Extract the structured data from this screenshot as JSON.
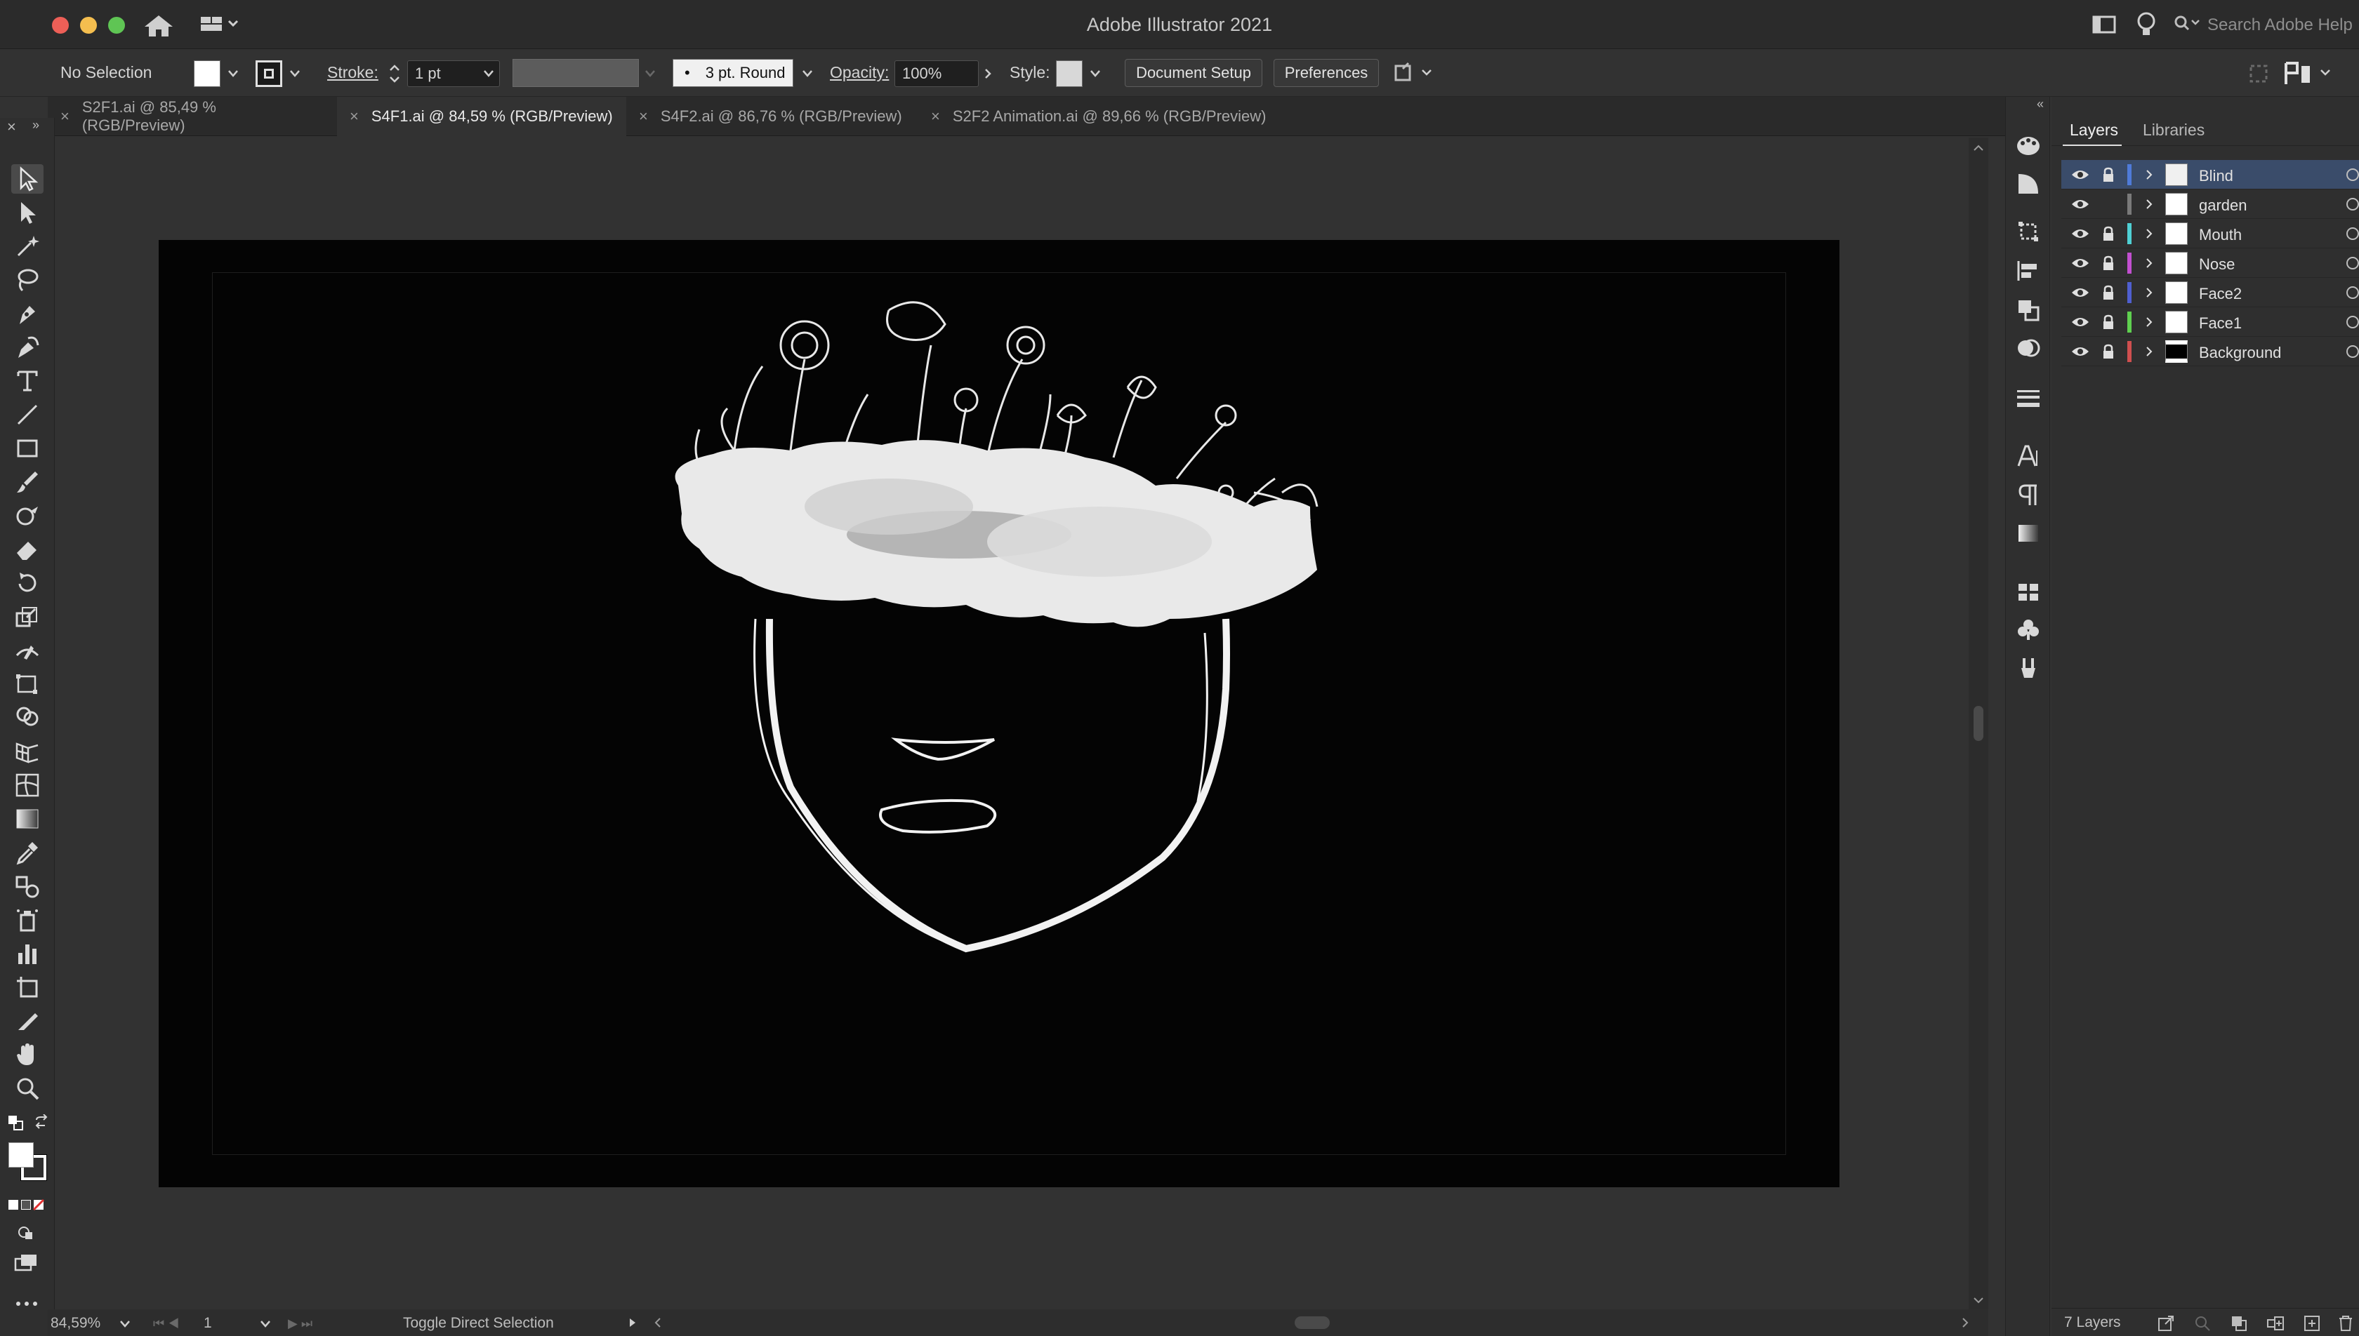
{
  "window": {
    "title": "Adobe Illustrator 2021",
    "help_placeholder": "Search Adobe Help"
  },
  "control_bar": {
    "selection": "No Selection",
    "stroke_label": "Stroke:",
    "stroke_value": "1 pt",
    "brush": "3 pt. Round",
    "opacity_label": "Opacity:",
    "opacity_value": "100%",
    "style_label": "Style:",
    "document_setup": "Document Setup",
    "preferences": "Preferences"
  },
  "tabs": [
    {
      "label": "S2F1.ai @ 85,49 % (RGB/Preview)",
      "active": false
    },
    {
      "label": "S4F1.ai @ 84,59 % (RGB/Preview)",
      "active": true
    },
    {
      "label": "S4F2.ai @ 86,76 % (RGB/Preview)",
      "active": false
    },
    {
      "label": "S2F2 Animation.ai @ 89,66 % (RGB/Preview)",
      "active": false
    }
  ],
  "tools": [
    "selection-tool",
    "direct-selection-tool",
    "magic-wand-tool",
    "lasso-tool",
    "pen-tool",
    "curvature-tool",
    "type-tool",
    "line-segment-tool",
    "rectangle-tool",
    "paintbrush-tool",
    "shaper-tool",
    "eraser-tool",
    "rotate-tool",
    "scale-tool",
    "width-tool",
    "free-transform-tool",
    "shape-builder-tool",
    "perspective-grid-tool",
    "mesh-tool",
    "gradient-tool",
    "eyedropper-tool",
    "blend-tool",
    "symbol-sprayer-tool",
    "column-graph-tool",
    "artboard-tool",
    "slice-tool",
    "hand-tool",
    "zoom-tool"
  ],
  "panel": {
    "tab_layers": "Layers",
    "tab_libraries": "Libraries",
    "layer_count": "7 Layers",
    "layers": [
      {
        "name": "Blind",
        "color": "#4f7bd9",
        "locked": true,
        "visible": true,
        "selected": true
      },
      {
        "name": "garden",
        "color": "#7a7a7a",
        "locked": false,
        "visible": true,
        "selected": false
      },
      {
        "name": "Mouth",
        "color": "#4fd0d4",
        "locked": true,
        "visible": true,
        "selected": false
      },
      {
        "name": "Nose",
        "color": "#c24fd0",
        "locked": true,
        "visible": true,
        "selected": false
      },
      {
        "name": "Face2",
        "color": "#4f5fd0",
        "locked": true,
        "visible": true,
        "selected": false
      },
      {
        "name": "Face1",
        "color": "#5fd04f",
        "locked": true,
        "visible": true,
        "selected": false
      },
      {
        "name": "Background",
        "color": "#d04f4f",
        "locked": true,
        "visible": true,
        "selected": false
      }
    ]
  },
  "status_bar": {
    "zoom": "84,59%",
    "artboard": "1",
    "status_text": "Toggle Direct Selection"
  }
}
